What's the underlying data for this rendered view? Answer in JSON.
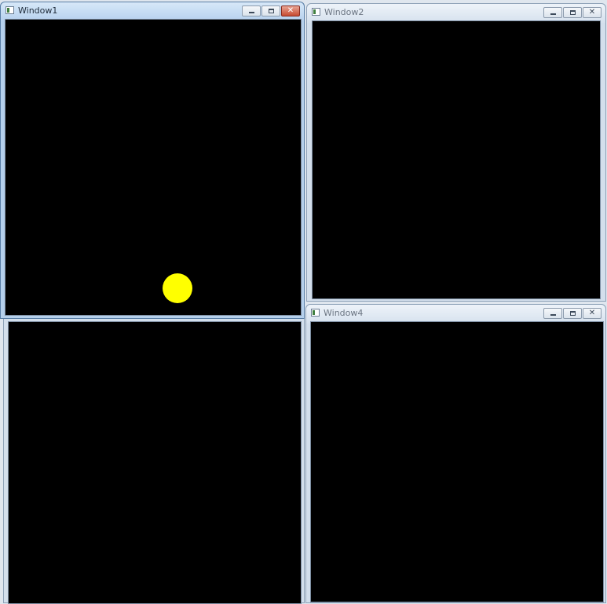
{
  "windows": [
    {
      "id": "window1",
      "title": "Window1",
      "active": true
    },
    {
      "id": "window2",
      "title": "Window2",
      "active": false
    },
    {
      "id": "window3",
      "title": "",
      "active": false
    },
    {
      "id": "window4",
      "title": "Window4",
      "active": false
    }
  ],
  "controls": {
    "minimize_glyph": "",
    "maximize_glyph": "",
    "close_glyph": "✕"
  },
  "scene": {
    "ball_color": "#ffff00",
    "canvas_color": "#000000"
  }
}
